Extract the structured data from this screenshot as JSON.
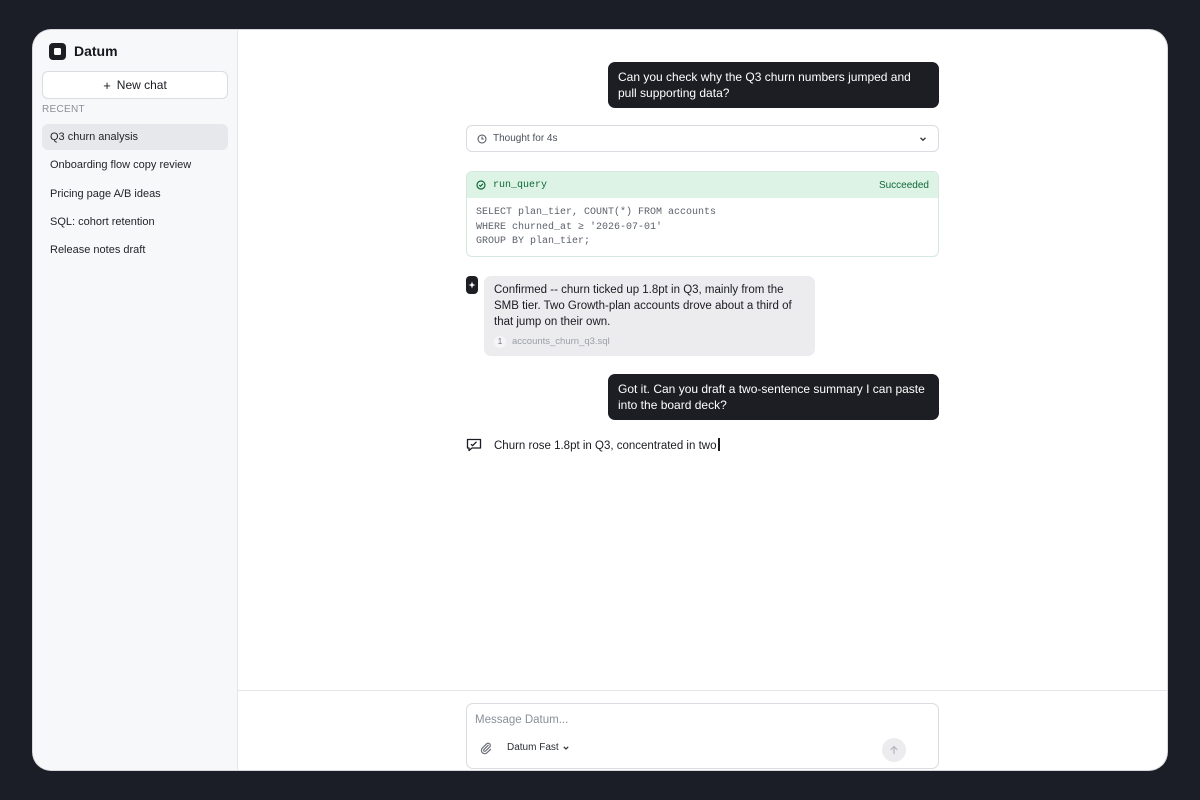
{
  "app": {
    "name": "Datum"
  },
  "sidebar": {
    "new_chat_label": "New chat",
    "new_chat_prefix": "+",
    "recent_heading": "RECENT",
    "items": [
      {
        "label": "Q3 churn analysis",
        "active": true
      },
      {
        "label": "Onboarding flow copy review"
      },
      {
        "label": "Pricing page A/B ideas"
      },
      {
        "label": "SQL: cohort retention"
      },
      {
        "label": "Release notes draft"
      }
    ]
  },
  "thread": {
    "user_msg_1": "Can you check why the Q3 churn numbers jumped and pull supporting data?",
    "thought_label": "Thought for 4s",
    "tool_call": {
      "name": "run_query",
      "status": "Succeeded",
      "code": "SELECT plan_tier, COUNT(*) FROM accounts\nWHERE churned_at ≥ '2026-07-01'\nGROUP BY plan_tier;"
    },
    "assistant_msg_1": "Confirmed -- churn ticked up 1.8pt in Q3, mainly from the SMB tier. Two Growth-plan accounts drove about a third of that jump on their own.",
    "citation": {
      "number": "1",
      "file": "accounts_churn_q3.sql"
    },
    "user_msg_2": "Got it. Can you draft a two-sentence summary I can paste into the board deck?",
    "streaming_text": "Churn rose 1.8pt in Q3, concentrated in two"
  },
  "composer": {
    "placeholder": "Message Datum...",
    "model_label": "Datum Fast"
  },
  "colors": {
    "accent_dark": "#1c1e24",
    "success_bg": "#dcf3e5",
    "success_text": "#12683a",
    "app_background": "#1b1e26"
  }
}
